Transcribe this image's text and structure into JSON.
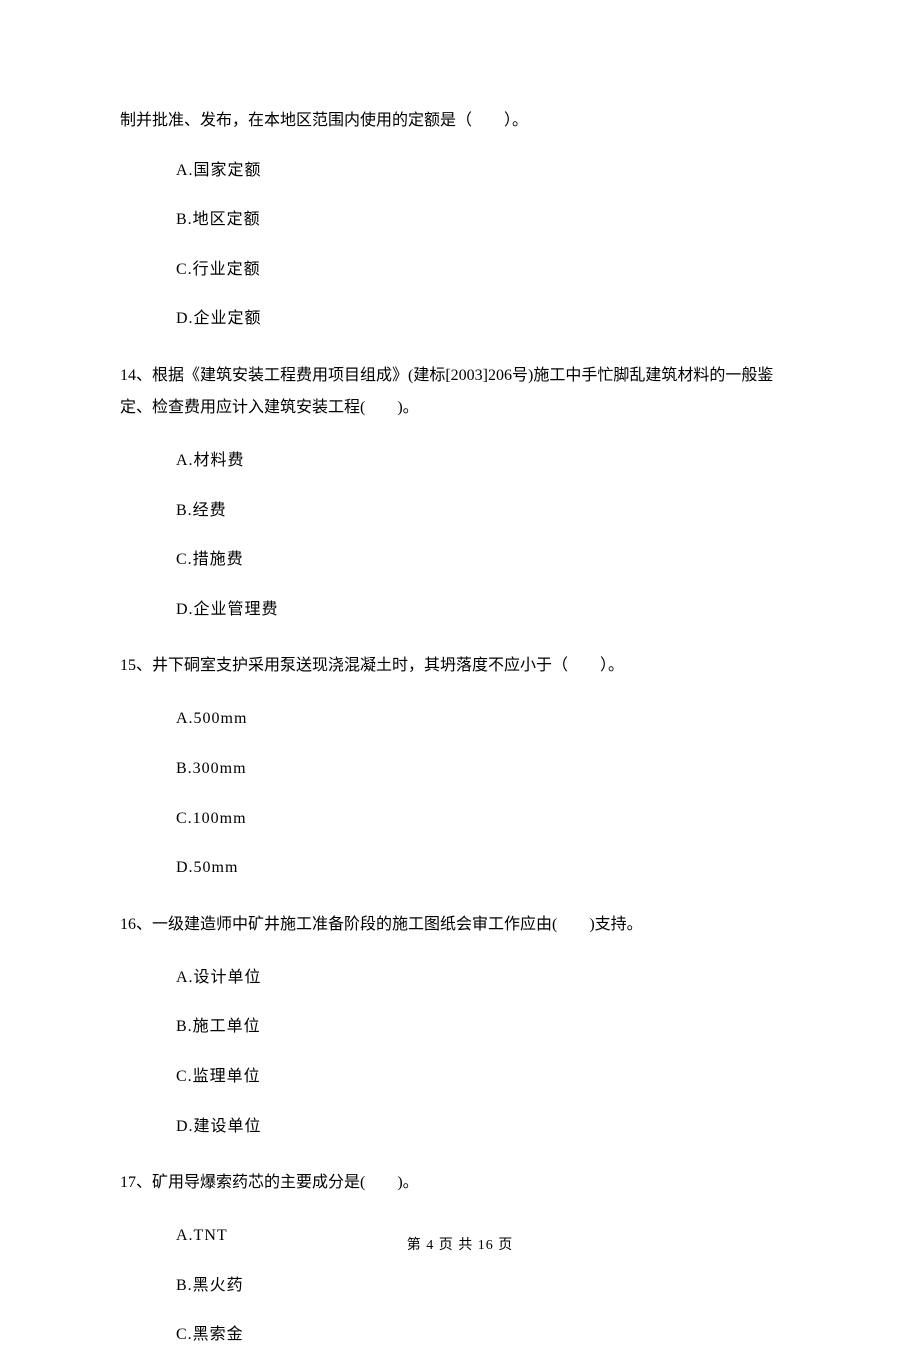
{
  "continuation": "制并批准、发布，在本地区范围内使用的定额是（　　）。",
  "q13_options": {
    "a": "A.国家定额",
    "b": "B.地区定额",
    "c": "C.行业定额",
    "d": "D.企业定额"
  },
  "q14": {
    "text": "14、根据《建筑安装工程费用项目组成》(建标[2003]206号)施工中手忙脚乱建筑材料的一般鉴定、检查费用应计入建筑安装工程(　　)。",
    "options": {
      "a": "A.材料费",
      "b": "B.经费",
      "c": "C.措施费",
      "d": "D.企业管理费"
    }
  },
  "q15": {
    "text": "15、井下硐室支护采用泵送现浇混凝土时，其坍落度不应小于（　　）。",
    "options": {
      "a": "A.500mm",
      "b": "B.300mm",
      "c": "C.100mm",
      "d": "D.50mm"
    }
  },
  "q16": {
    "text": "16、一级建造师中矿井施工准备阶段的施工图纸会审工作应由(　　)支持。",
    "options": {
      "a": "A.设计单位",
      "b": "B.施工单位",
      "c": "C.监理单位",
      "d": "D.建设单位"
    }
  },
  "q17": {
    "text": "17、矿用导爆索药芯的主要成分是(　　)。",
    "options": {
      "a": "A.TNT",
      "b": "B.黑火药",
      "c": "C.黑索金"
    }
  },
  "footer": "第 4 页 共 16 页"
}
